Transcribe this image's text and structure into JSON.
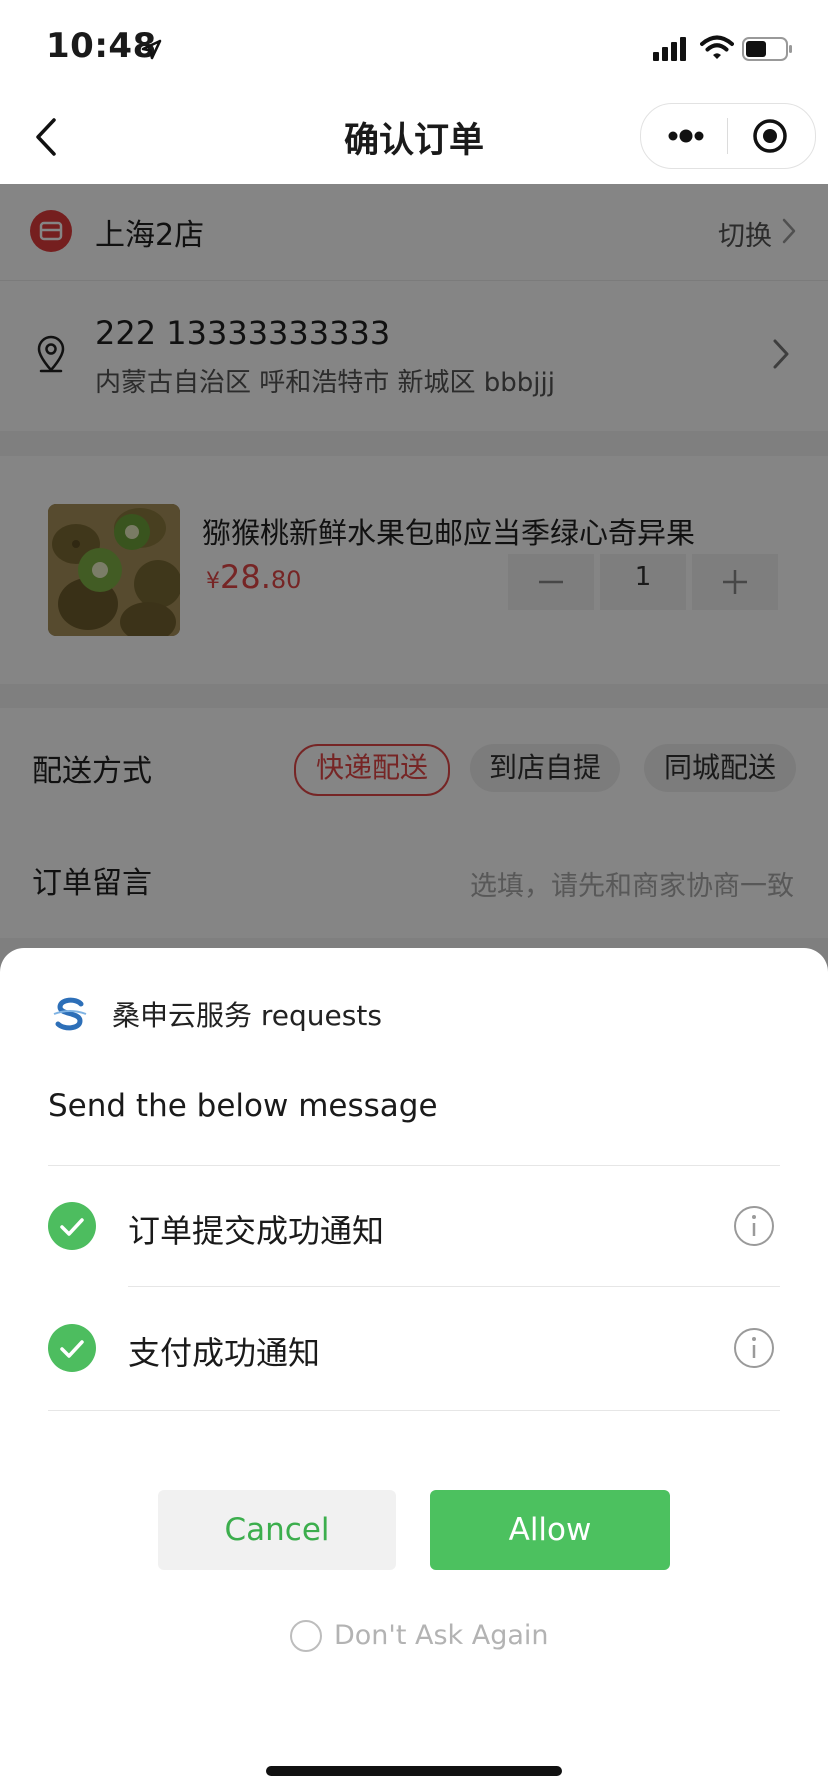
{
  "status_bar": {
    "time": "10:48"
  },
  "nav": {
    "title": "确认订单"
  },
  "store": {
    "name": "上海2店",
    "switch_label": "切换"
  },
  "address": {
    "contact": "222 13333333333",
    "detail": "内蒙古自治区 呼和浩特市 新城区 bbbjjj"
  },
  "product": {
    "title": "猕猴桃新鲜水果包邮应当季绿心奇异果",
    "price_symbol": "¥",
    "price_int": "28.",
    "price_dec": "80",
    "quantity": "1"
  },
  "delivery": {
    "label": "配送方式",
    "options": [
      "快递配送",
      "到店自提",
      "同城配送"
    ],
    "selected": "快递配送"
  },
  "note": {
    "label": "订单留言",
    "placeholder": "选填，请先和商家协商一致"
  },
  "sheet": {
    "requester": "桑申云服务 requests",
    "heading": "Send the below message",
    "messages": [
      "订单提交成功通知",
      "支付成功通知"
    ],
    "cancel_label": "Cancel",
    "allow_label": "Allow",
    "dont_ask_label": "Don't Ask Again"
  },
  "colors": {
    "accent_green": "#4cc15f",
    "price_red": "#e24848",
    "store_red": "#e03c3c"
  },
  "icons": [
    "location-arrow-icon",
    "signal-icon",
    "wifi-icon",
    "battery-icon",
    "back-icon",
    "more-icon",
    "close-miniapp-icon",
    "store-icon",
    "chevron-right-icon",
    "location-pin-icon",
    "minus-icon",
    "plus-icon",
    "check-icon",
    "info-icon",
    "app-logo"
  ]
}
